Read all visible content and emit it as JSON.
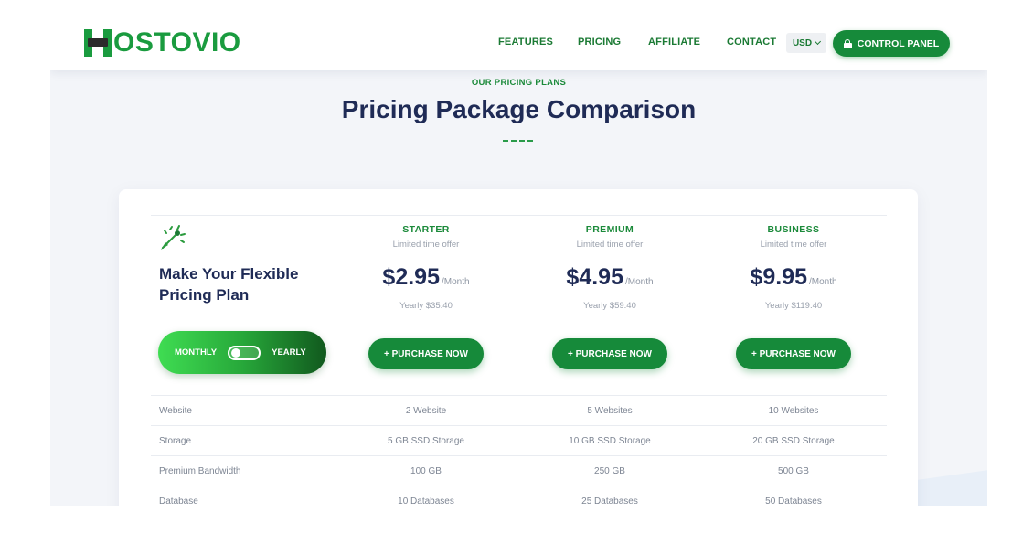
{
  "brand": {
    "name": "OSTOVIO",
    "color": "#1a9b3f"
  },
  "nav": [
    {
      "label": "FEATURES"
    },
    {
      "label": "PRICING"
    },
    {
      "label": "AFFILIATE"
    },
    {
      "label": "CONTACT"
    }
  ],
  "currency": {
    "value": "USD"
  },
  "control_panel": {
    "label": "CONTROL PANEL"
  },
  "section": {
    "eyebrow": "OUR PRICING PLANS",
    "title": "Pricing Package Comparison"
  },
  "intro": {
    "icon": "rocket-icon",
    "heading_line1": "Make Your Flexible",
    "heading_line2": "Pricing Plan"
  },
  "billing_toggle": {
    "monthly": "MONTHLY",
    "yearly": "YEARLY",
    "selected": "monthly"
  },
  "plans": [
    {
      "name": "STARTER",
      "offer": "Limited time offer",
      "price": "$2.95",
      "period": "/Month",
      "yearly": "Yearly $35.40",
      "button": "+ PURCHASE NOW"
    },
    {
      "name": "PREMIUM",
      "offer": "Limited time offer",
      "price": "$4.95",
      "period": "/Month",
      "yearly": "Yearly $59.40",
      "button": "+ PURCHASE NOW"
    },
    {
      "name": "BUSINESS",
      "offer": "Limited time offer",
      "price": "$9.95",
      "period": "/Month",
      "yearly": "Yearly $119.40",
      "button": "+ PURCHASE NOW"
    }
  ],
  "features": [
    {
      "label": "Website",
      "values": [
        "2 Website",
        "5 Websites",
        "10 Websites"
      ]
    },
    {
      "label": "Storage",
      "values": [
        "5 GB SSD Storage",
        "10 GB SSD Storage",
        "20 GB SSD Storage"
      ]
    },
    {
      "label": "Premium Bandwidth",
      "values": [
        "100 GB",
        "250 GB",
        "500 GB"
      ]
    },
    {
      "label": "Database",
      "values": [
        "10 Databases",
        "25 Databases",
        "50 Databases"
      ]
    }
  ],
  "colors": {
    "accent": "#168a3a",
    "heading": "#1f2b56"
  }
}
